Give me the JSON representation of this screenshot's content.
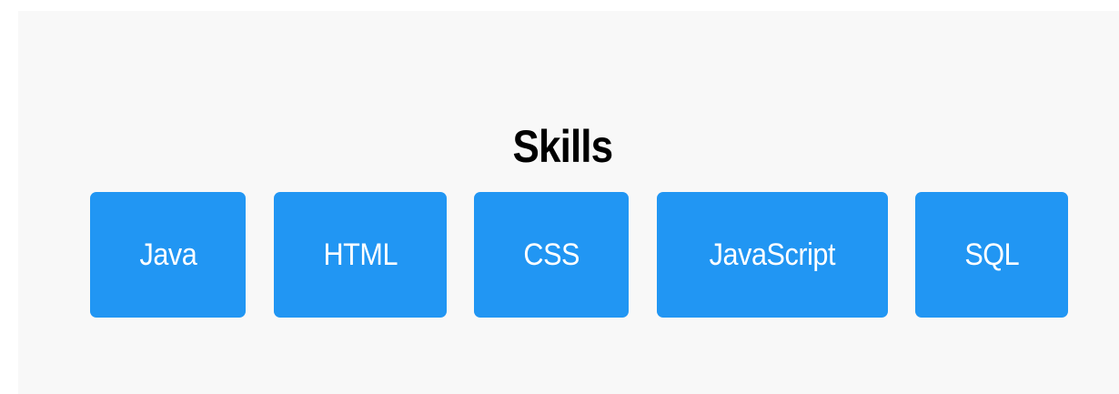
{
  "section": {
    "title": "Skills",
    "skills": [
      {
        "label": "Java"
      },
      {
        "label": "HTML"
      },
      {
        "label": "CSS"
      },
      {
        "label": "JavaScript"
      },
      {
        "label": "SQL"
      }
    ]
  },
  "colors": {
    "background": "#f8f8f8",
    "skill_tile": "#2196f3",
    "skill_text": "#ffffff",
    "title_text": "#000000"
  }
}
